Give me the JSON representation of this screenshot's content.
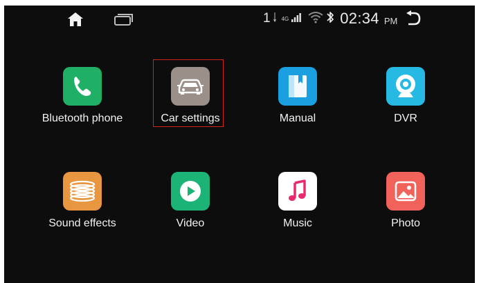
{
  "status_bar": {
    "sim_number": "1",
    "network_type": "4G",
    "time": "02:34",
    "ampm": "PM",
    "icons": [
      "home-icon",
      "recent-apps-icon",
      "signal-icon",
      "wifi-icon",
      "bluetooth-icon",
      "back-icon"
    ]
  },
  "apps": [
    {
      "label": "Bluetooth phone",
      "icon": "phone-icon",
      "color": "#1fb065"
    },
    {
      "label": "Car settings",
      "icon": "car-icon",
      "color": "#9a8f89",
      "selected": true
    },
    {
      "label": "Manual",
      "icon": "book-icon",
      "color": "#1a9fe0"
    },
    {
      "label": "DVR",
      "icon": "camera-icon",
      "color": "#25b9e3"
    },
    {
      "label": "Sound effects",
      "icon": "speaker-icon",
      "color": "#e8963f"
    },
    {
      "label": "Video",
      "icon": "play-icon",
      "color": "#1bb476"
    },
    {
      "label": "Music",
      "icon": "music-note-icon",
      "color": "#ffffff"
    },
    {
      "label": "Photo",
      "icon": "image-icon",
      "color": "#f0625a"
    }
  ],
  "colors": {
    "background": "#0d0d0d",
    "selection_outline": "#d8201f"
  }
}
